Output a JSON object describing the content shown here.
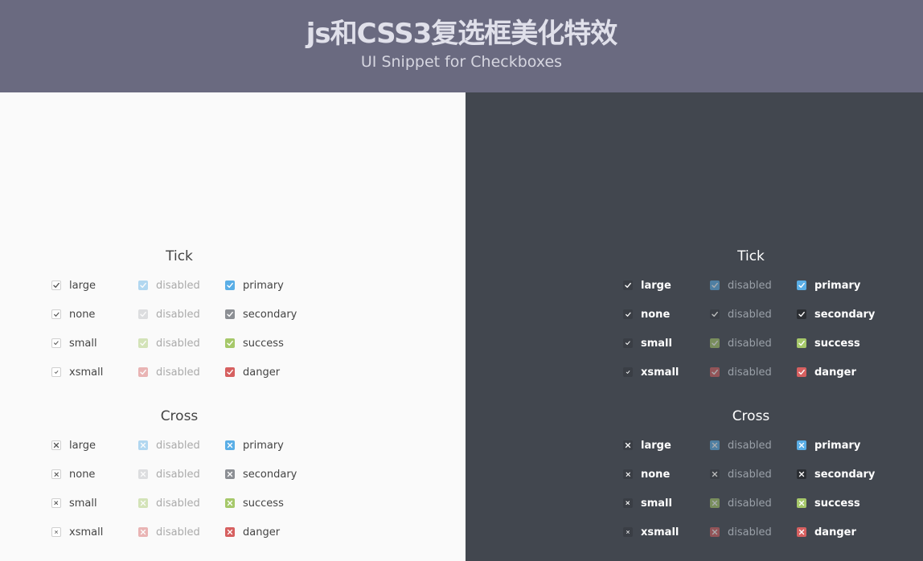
{
  "header": {
    "title": "js和CSS3复选框美化特效",
    "subtitle": "UI Snippet for Checkboxes"
  },
  "colors": {
    "header_bg": "#6a6a80",
    "light_bg": "#fafafa",
    "dark_bg": "#42474f",
    "primary": "#5aaee6",
    "secondary": "#8c8f94",
    "success": "#a6c86a",
    "danger": "#d66060"
  },
  "sections": [
    {
      "title": "Tick",
      "mark": "tick"
    },
    {
      "title": "Cross",
      "mark": "cross"
    }
  ],
  "columns": {
    "sizes": [
      "large",
      "none",
      "small",
      "xsmall"
    ],
    "disabled": [
      "disabled",
      "disabled",
      "disabled",
      "disabled"
    ],
    "styles": [
      "primary",
      "secondary",
      "success",
      "danger"
    ]
  }
}
